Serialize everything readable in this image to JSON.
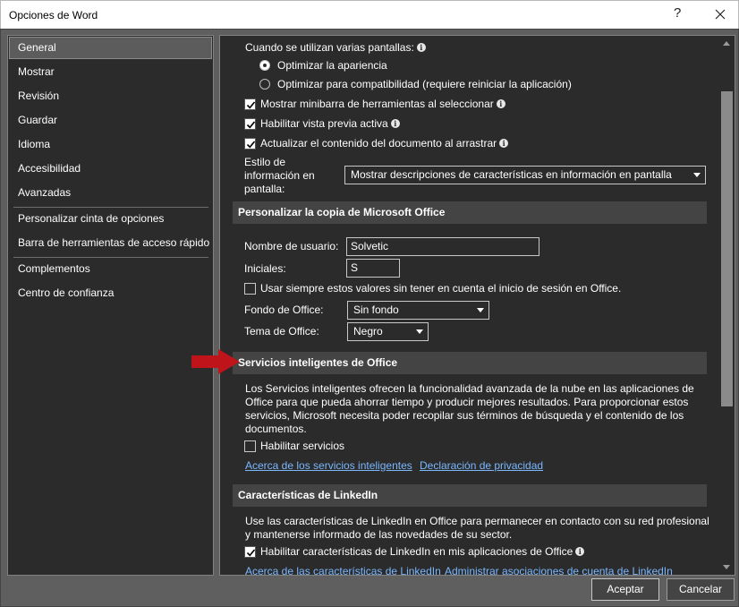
{
  "window": {
    "title": "Opciones de Word",
    "help": "?"
  },
  "nav": {
    "items": [
      "General",
      "Mostrar",
      "Revisión",
      "Guardar",
      "Idioma",
      "Accesibilidad",
      "Avanzadas",
      "Personalizar cinta de opciones",
      "Barra de herramientas de acceso rápido",
      "Complementos",
      "Centro de confianza"
    ],
    "selected": "General"
  },
  "general": {
    "multi_screen_label": "Cuando se utilizan varias pantallas:",
    "radio_optimize_appearance": "Optimizar la apariencia",
    "radio_optimize_compat": "Optimizar para compatibilidad (requiere reiniciar la aplicación)",
    "cb_minibar": "Mostrar minibarra de herramientas al seleccionar",
    "cb_live_preview": "Habilitar vista previa activa",
    "cb_update_drag": "Actualizar el contenido del documento al arrastrar",
    "tooltip_style_label_1": "Estilo de",
    "tooltip_style_label_2": "información en",
    "tooltip_style_label_3": "pantalla:",
    "tooltip_style_value": "Mostrar descripciones de características en información en pantalla"
  },
  "personalize": {
    "header": "Personalizar la copia de Microsoft Office",
    "username_label": "Nombre de usuario:",
    "username_value": "Solvetic",
    "initials_label": "Iniciales:",
    "initials_value": "S",
    "cb_always_use": "Usar siempre estos valores sin tener en cuenta el inicio de sesión en Office.",
    "background_label": "Fondo de Office:",
    "background_value": "Sin fondo",
    "theme_label": "Tema de Office:",
    "theme_value": "Negro"
  },
  "intelligent": {
    "header": "Servicios inteligentes de Office",
    "description": "Los Servicios inteligentes ofrecen la funcionalidad avanzada de la nube en las aplicaciones de Office para que pueda ahorrar tiempo y producir mejores resultados. Para proporcionar estos servicios, Microsoft necesita poder recopilar sus términos de búsqueda y el contenido de los documentos.",
    "cb_enable": "Habilitar servicios",
    "link_about": "Acerca de los servicios inteligentes",
    "link_privacy": "Declaración de privacidad"
  },
  "linkedin": {
    "header": "Características de LinkedIn",
    "description": "Use las características de LinkedIn en Office para permanecer en contacto con su red profesional y mantenerse informado de las novedades de su sector.",
    "cb_enable": "Habilitar características de LinkedIn en mis aplicaciones de Office",
    "link_about": "Acerca de las características de LinkedIn",
    "link_manage": "Administrar asociaciones de cuenta de LinkedIn"
  },
  "buttons": {
    "accept": "Aceptar",
    "cancel": "Cancelar"
  },
  "colors": {
    "background": "#5f5f5f",
    "panel": "#2b2b2b",
    "section": "#444444",
    "link": "#7ab7ff",
    "annotation_arrow": "#c0141b"
  }
}
